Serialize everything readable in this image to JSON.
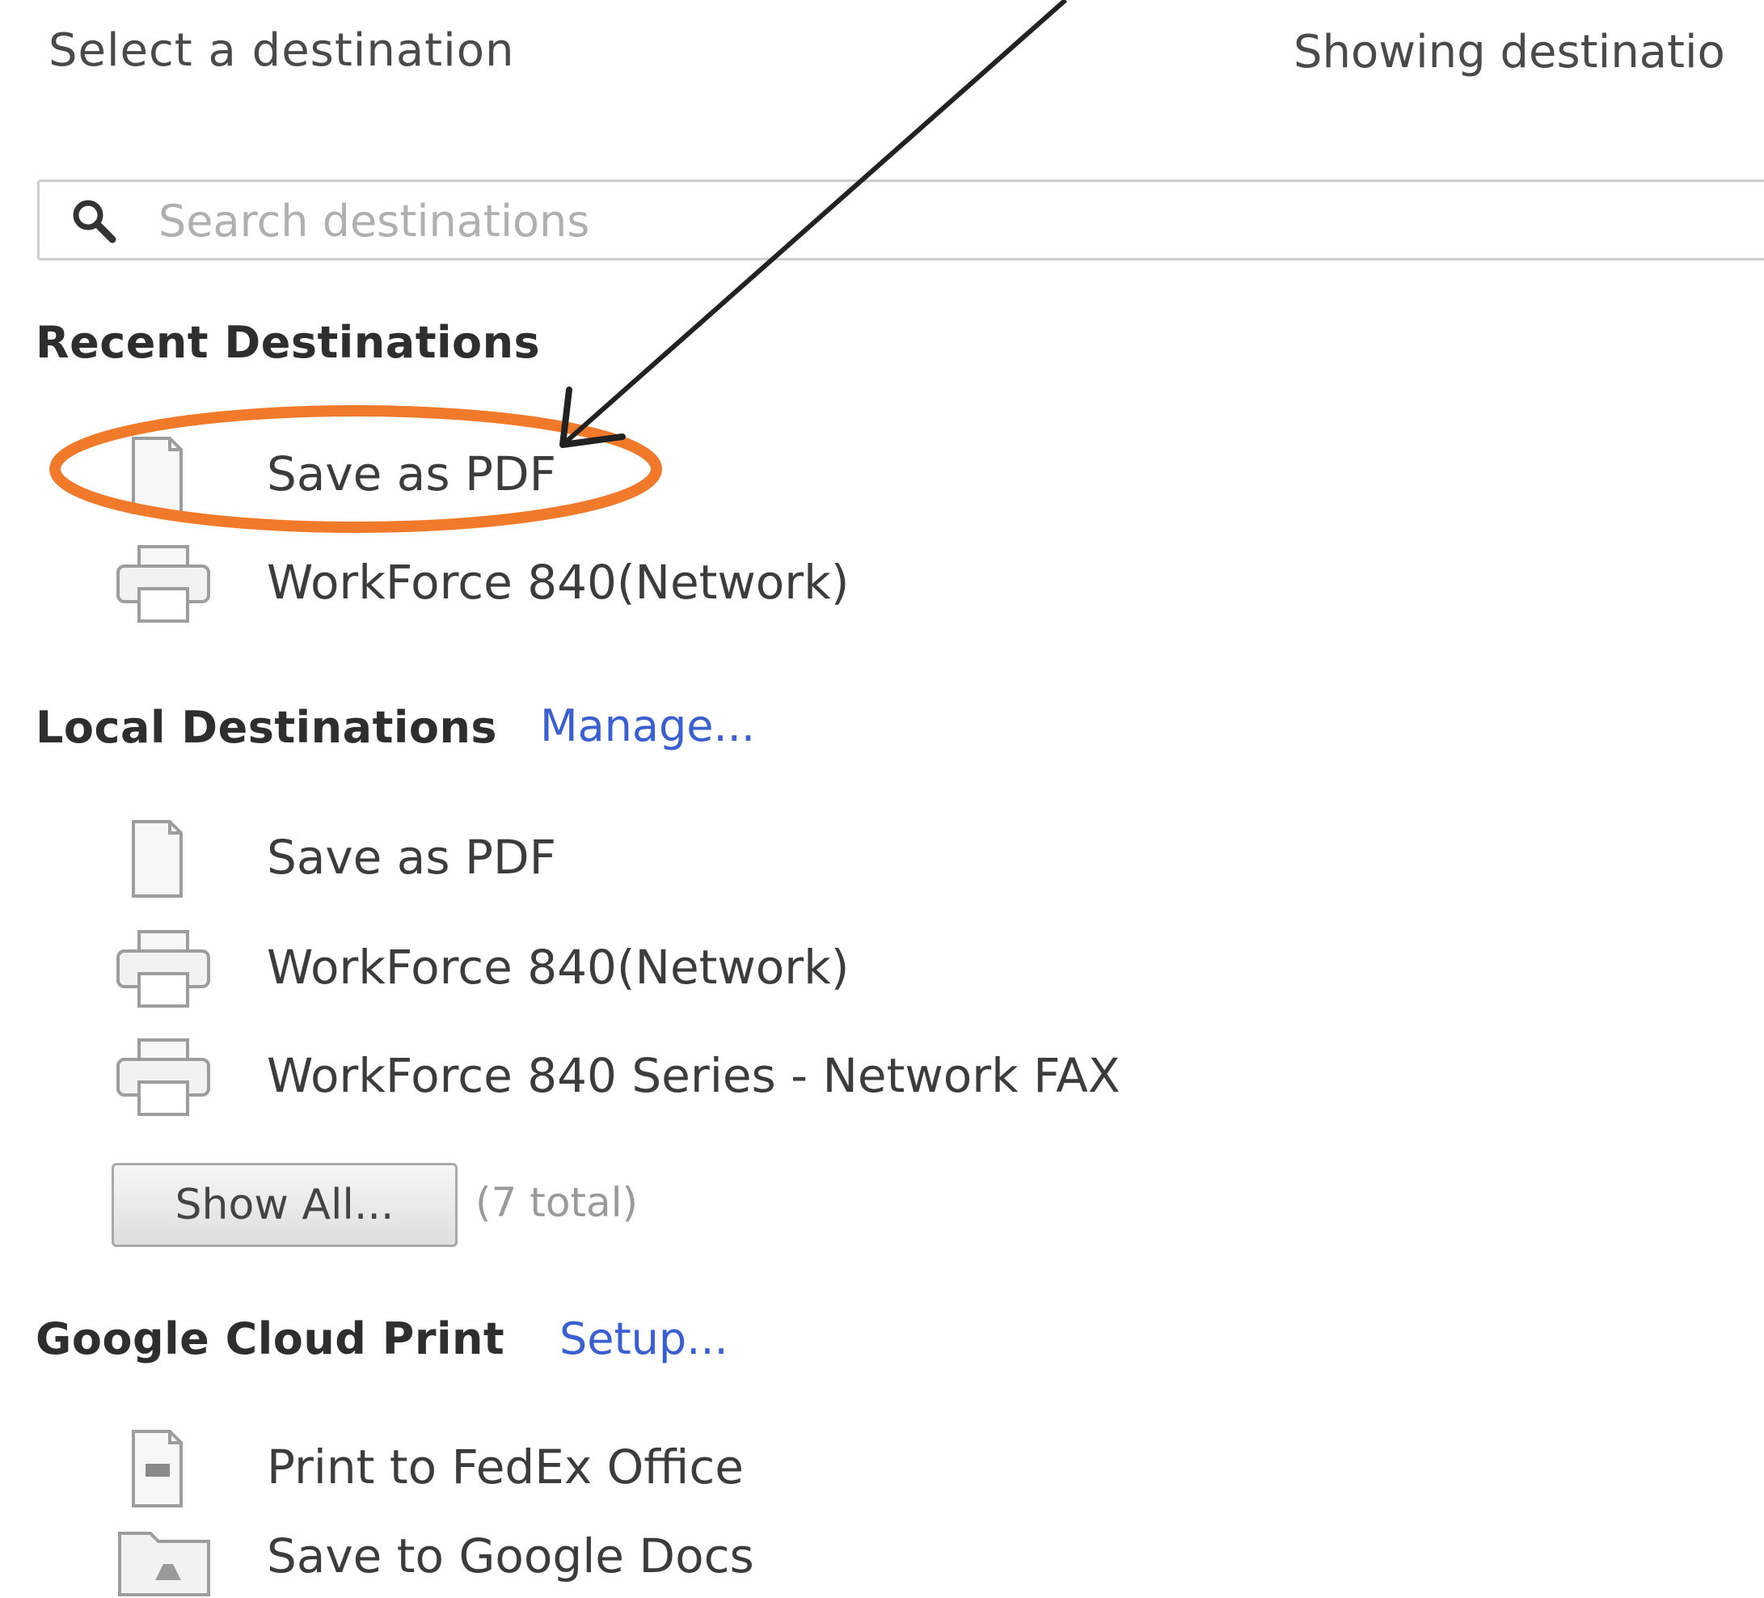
{
  "header": {
    "title": "Select a destination",
    "showing": "Showing destinatio"
  },
  "search": {
    "placeholder": "Search destinations",
    "icon": "search-icon"
  },
  "recent": {
    "heading": "Recent Destinations",
    "items": [
      {
        "label": "Save as PDF",
        "icon": "document-icon"
      },
      {
        "label": "WorkForce 840(Network)",
        "icon": "printer-icon"
      }
    ]
  },
  "local": {
    "heading": "Local Destinations",
    "manage_label": "Manage...",
    "items": [
      {
        "label": "Save as PDF",
        "icon": "document-icon"
      },
      {
        "label": "WorkForce 840(Network)",
        "icon": "printer-icon"
      },
      {
        "label": "WorkForce 840 Series - Network FAX",
        "icon": "printer-icon"
      }
    ],
    "show_all_label": "Show All...",
    "total_text": "(7 total)"
  },
  "cloud": {
    "heading": "Google Cloud Print",
    "setup_label": "Setup...",
    "items": [
      {
        "label": "Print to FedEx Office",
        "icon": "fedex-document-icon"
      },
      {
        "label": "Save to Google Docs",
        "icon": "google-drive-folder-icon"
      }
    ]
  },
  "colors": {
    "link": "#3a5fd0",
    "highlight_ellipse": "#f07a2a",
    "arrow": "#222222"
  }
}
